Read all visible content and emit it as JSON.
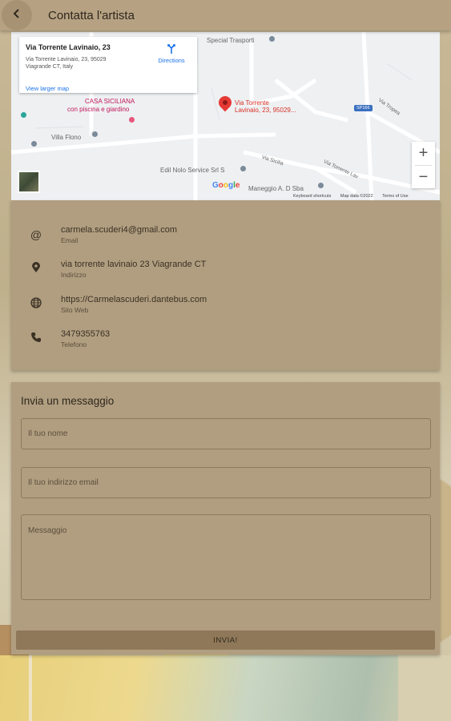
{
  "header": {
    "title": "Contatta l'artista",
    "back_icon": "arrow-back-icon"
  },
  "map": {
    "card": {
      "title": "Via Torrente Lavinaio, 23",
      "address_line1": "Via Torrente Lavinaio, 23, 95029",
      "address_line2": "Viagrande CT, Italy",
      "larger_map_link": "View larger map",
      "directions_label": "Directions"
    },
    "labels": {
      "special_trasporti": "Special Trasporti",
      "casa_siciliana_1": "CASA SICILIANA",
      "casa_siciliana_2": "con piscina e giardino",
      "villa_flono": "Villa Flono",
      "pin_label_1": "Via Torrente",
      "pin_label_2": "Lavinaio, 23, 95029...",
      "edil_nolo": "Edil Nolo Service Srl S",
      "maneggio": "Maneggio A. D Sba",
      "via_sicilia": "Via Sicilia",
      "via_torrente_lav": "Via Torrente Lav",
      "via_tropea": "Via Tropea",
      "road_badge": "SP166"
    },
    "zoom_in": "+",
    "zoom_out": "−",
    "google": [
      "G",
      "o",
      "o",
      "g",
      "l",
      "e"
    ],
    "footer": {
      "shortcuts": "Keyboard shortcuts",
      "mapdata": "Map data ©2022",
      "terms": "Terms of Use"
    }
  },
  "contact": {
    "items": [
      {
        "icon": "at-icon",
        "value": "carmela.scuderi4@gmail.com",
        "label": "Email"
      },
      {
        "icon": "location-pin-icon",
        "value": "via torrente lavinaio 23 Viagrande CT",
        "label": "Indirizzo"
      },
      {
        "icon": "globe-icon",
        "value": "https://Carmelascuderi.dantebus.com",
        "label": "Sito Web"
      },
      {
        "icon": "phone-icon",
        "value": "3479355763",
        "label": "Telefono"
      }
    ]
  },
  "message": {
    "title": "Invia un messaggio",
    "name_placeholder": "Il tuo nome",
    "email_placeholder": "Il tuo indirizzo email",
    "message_placeholder": "Messaggio",
    "send_label": "INVIA!"
  }
}
